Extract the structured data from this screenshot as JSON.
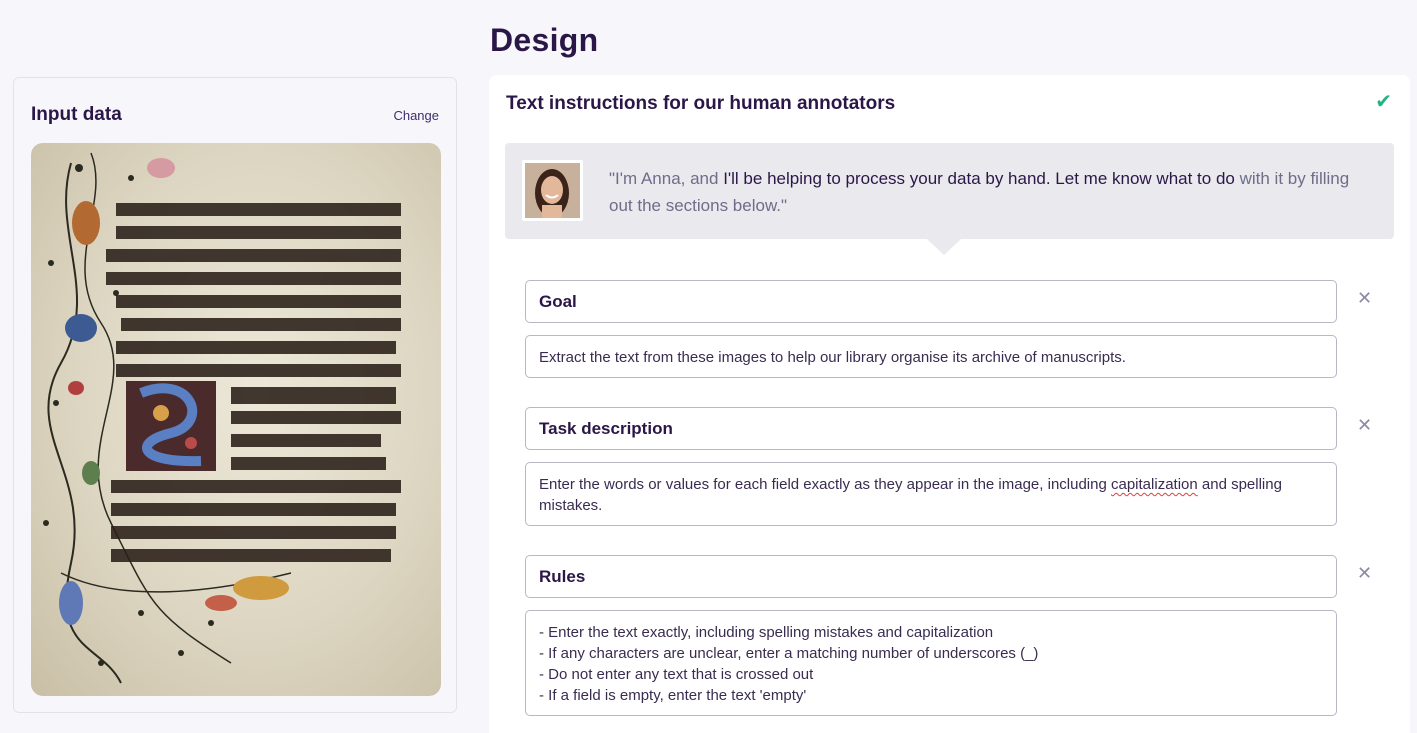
{
  "page": {
    "title": "Design"
  },
  "input_panel": {
    "title": "Input data",
    "change_label": "Change"
  },
  "instructions": {
    "title": "Text instructions for our human annotators",
    "check_icon": "check-icon",
    "speech": {
      "part1": "\"I'm Anna, and ",
      "part2": "I'll be helping to process your data by hand. Let me know what to do",
      "part3": " with it by filling out the sections below.\""
    },
    "sections": [
      {
        "heading": "Goal",
        "body": "Extract the text from these images to help our library organise its archive of manuscripts."
      },
      {
        "heading": "Task description",
        "body_before": "Enter the words or values for each field exactly as they appear in the image, including ",
        "body_spell": "capitalization",
        "body_after": " and spelling mistakes."
      },
      {
        "heading": "Rules",
        "lines": [
          "- Enter the text exactly, including spelling mistakes and capitalization",
          "- If any characters are unclear, enter a matching number of underscores (_)",
          "- Do not enter any text that is crossed out",
          "- If a field is empty, enter the text 'empty'"
        ]
      }
    ],
    "remove_icon": "close-icon"
  },
  "colors": {
    "accent": "#2b1747",
    "check": "#24b384",
    "speech_bg": "#e9e9ee"
  }
}
